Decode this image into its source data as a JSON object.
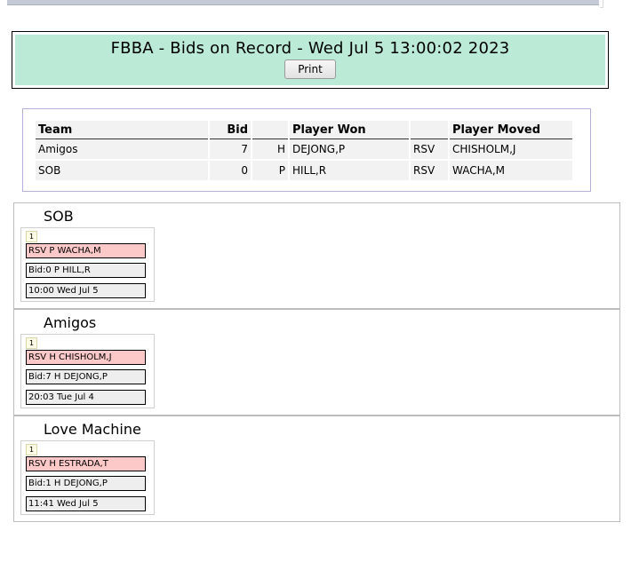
{
  "header": {
    "title": "FBBA - Bids on Record - Wed Jul 5 13:00:02 2023",
    "print_label": "Print"
  },
  "summary": {
    "columns": [
      "Team",
      "Bid",
      "",
      "Player Won",
      "",
      "Player Moved"
    ],
    "rows": [
      {
        "team": "Amigos",
        "bid": "7",
        "pos": "H",
        "player_won": "DEJONG,P",
        "move_type": "RSV",
        "player_moved": "CHISHOLM,J"
      },
      {
        "team": "SOB",
        "bid": "0",
        "pos": "P",
        "player_won": "HILL,R",
        "move_type": "RSV",
        "player_moved": "WACHA,M"
      }
    ]
  },
  "teams": [
    {
      "name": "SOB",
      "cards": [
        {
          "badge": "1",
          "rsv": "RSV P WACHA,M",
          "bid": "Bid:0 P HILL,R",
          "time": "10:00 Wed Jul 5"
        }
      ]
    },
    {
      "name": "Amigos",
      "cards": [
        {
          "badge": "1",
          "rsv": "RSV H CHISHOLM,J",
          "bid": "Bid:7 H DEJONG,P",
          "time": "20:03 Tue Jul 4"
        }
      ]
    },
    {
      "name": "Love Machine",
      "cards": [
        {
          "badge": "1",
          "rsv": "RSV H ESTRADA,T",
          "bid": "Bid:1 H DEJONG,P",
          "time": "11:41 Wed Jul 5"
        }
      ]
    }
  ],
  "colors": {
    "header_bg": "#bbead6",
    "rsv_bg": "#fdc8c8",
    "summary_border": "#b4b0d8"
  }
}
